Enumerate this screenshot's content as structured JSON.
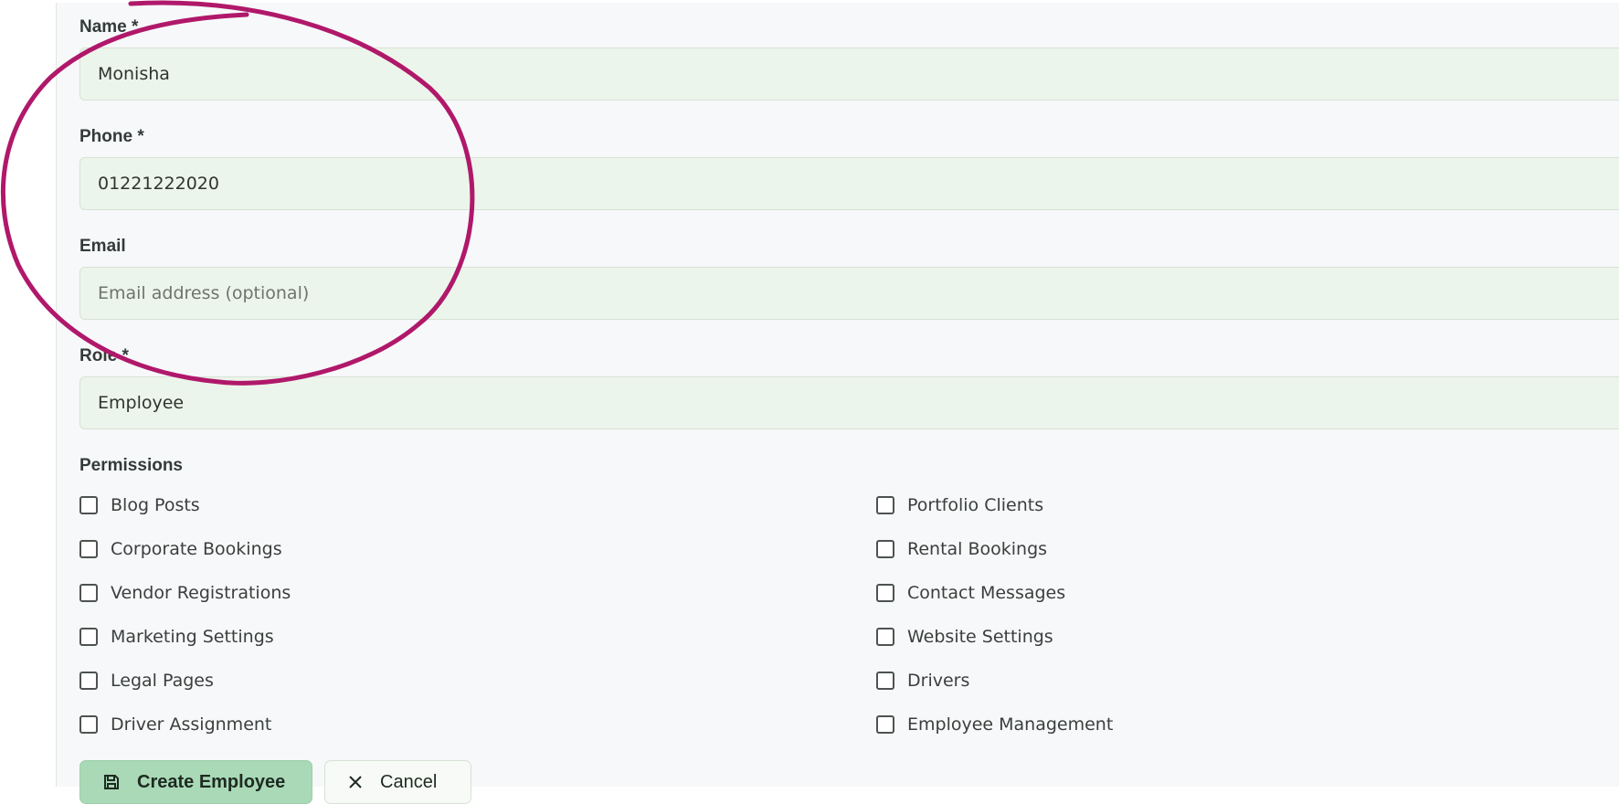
{
  "form": {
    "name_label": "Name *",
    "name_value": "Monisha",
    "phone_label": "Phone *",
    "phone_value": "01221222020",
    "email_label": "Email",
    "email_placeholder": "Email address (optional)",
    "role_label": "Role *",
    "role_value": "Employee"
  },
  "permissions": {
    "title": "Permissions",
    "left": [
      "Blog Posts",
      "Corporate Bookings",
      "Vendor Registrations",
      "Marketing Settings",
      "Legal Pages",
      "Driver Assignment"
    ],
    "right": [
      "Portfolio Clients",
      "Rental Bookings",
      "Contact Messages",
      "Website Settings",
      "Drivers",
      "Employee Management"
    ]
  },
  "actions": {
    "create_label": "Create Employee",
    "cancel_label": "Cancel"
  },
  "colors": {
    "accent": "#a9d9b6",
    "input_bg": "#ecf5eb",
    "annotation": "#b0186a"
  },
  "icons": {
    "create": "save-icon",
    "cancel": "close-icon"
  }
}
